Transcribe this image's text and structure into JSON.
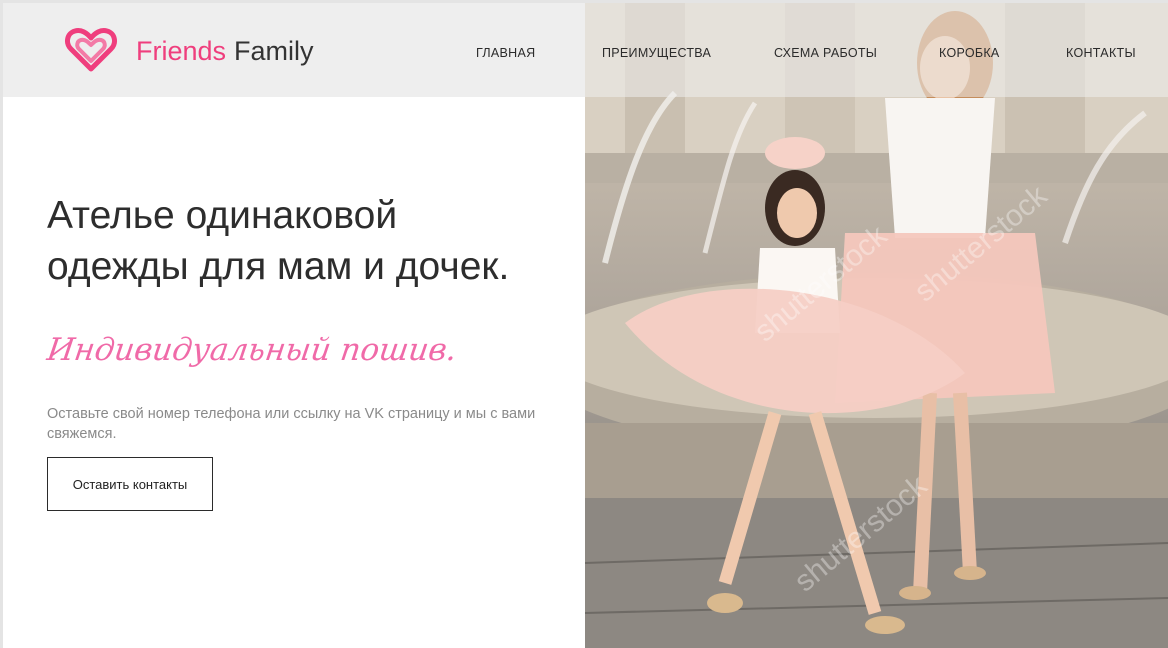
{
  "brand": {
    "name_part1": "Friends",
    "name_part2": "Family",
    "logo_icon": "double-heart-icon",
    "accent": "#ef3e7d"
  },
  "nav": {
    "items": [
      {
        "label": "ГЛАВНАЯ"
      },
      {
        "label": "ПРЕИМУЩЕСТВА"
      },
      {
        "label": "СХЕМА РАБОТЫ"
      },
      {
        "label": "КОРОБКА"
      },
      {
        "label": "КОНТАКТЫ"
      }
    ]
  },
  "hero": {
    "title_line1": "Ателье одинаковой",
    "title_line2": "одежды для мам и дочек.",
    "script_tagline": "Индивидуальный пошив.",
    "description": "Оставьте свой номер телефона или ссылку на VK страницу и мы с вами свяжемся.",
    "cta_label": "Оставить контакты"
  },
  "photo": {
    "subject": "mother and daughter in matching pink tulle skirts by a fountain",
    "watermark": "shutterstock"
  }
}
